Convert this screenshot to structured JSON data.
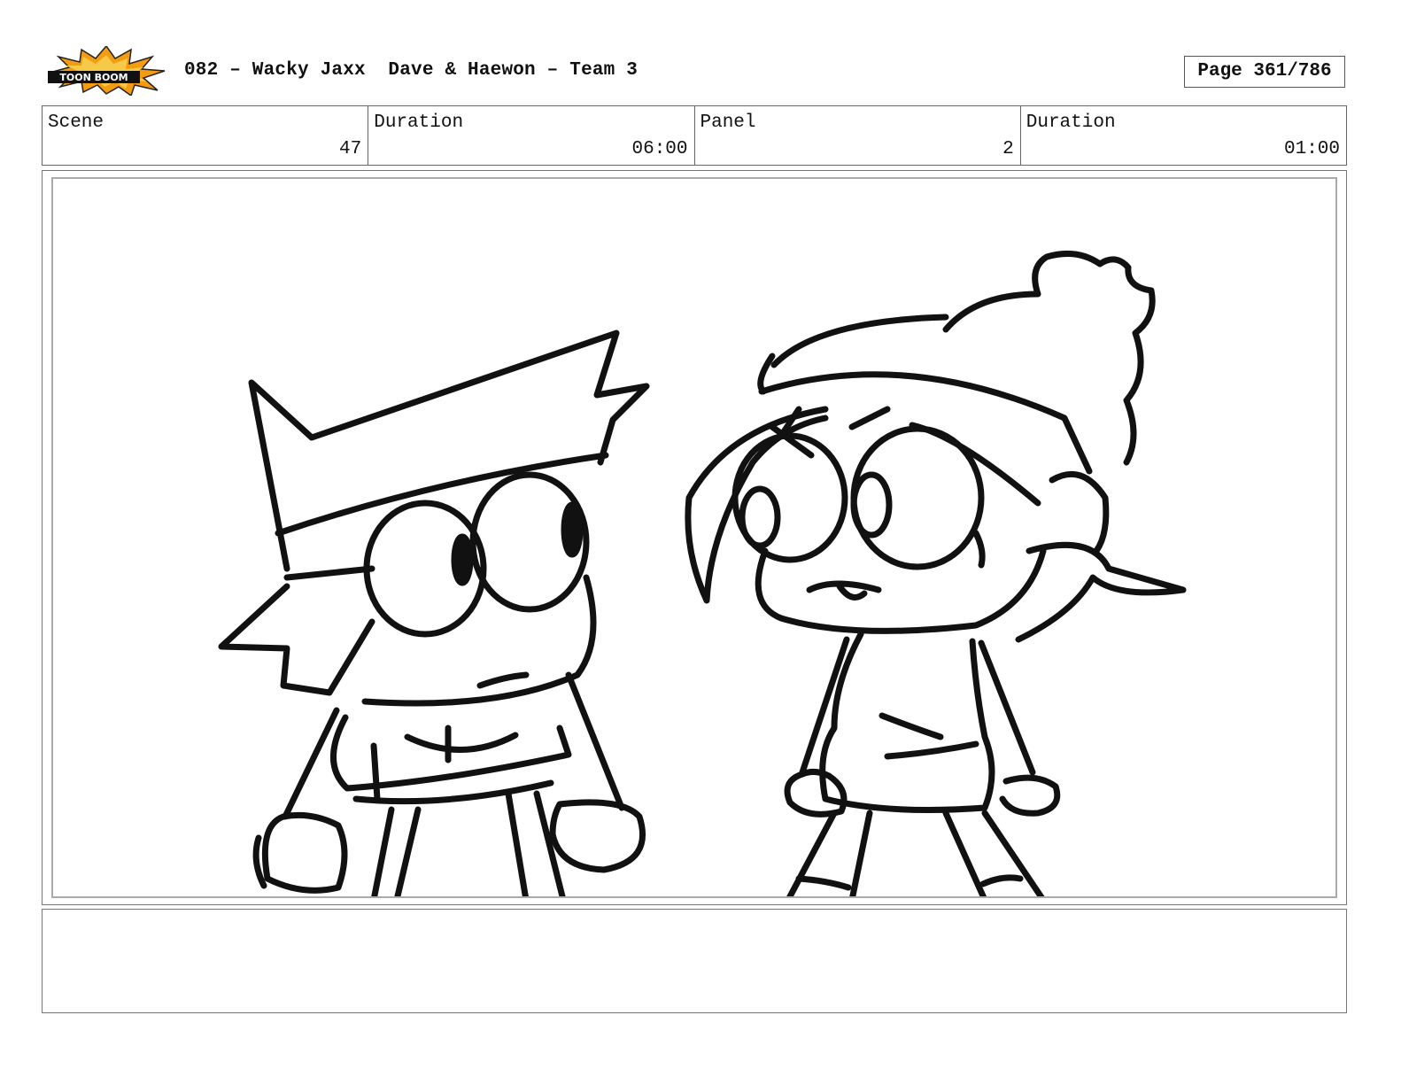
{
  "header": {
    "logo_text": "TOON BOOM",
    "title": "082 – Wacky Jaxx  Dave & Haewon – Team 3",
    "page_label": "Page 361/786"
  },
  "info": {
    "scene_label": "Scene",
    "scene_value": "47",
    "duration_label": "Duration",
    "duration_value": "06:00",
    "panel_label": "Panel",
    "panel_value": "2",
    "panel_duration_label": "Duration",
    "panel_duration_value": "01:00"
  },
  "panel": {
    "description": "",
    "characters": [
      "boy-with-headband",
      "girl-with-beanie"
    ]
  },
  "notes": {
    "text": ""
  },
  "colors": {
    "logo_burst": "#f39c12",
    "logo_inner": "#f7c948",
    "ink": "#111111"
  }
}
